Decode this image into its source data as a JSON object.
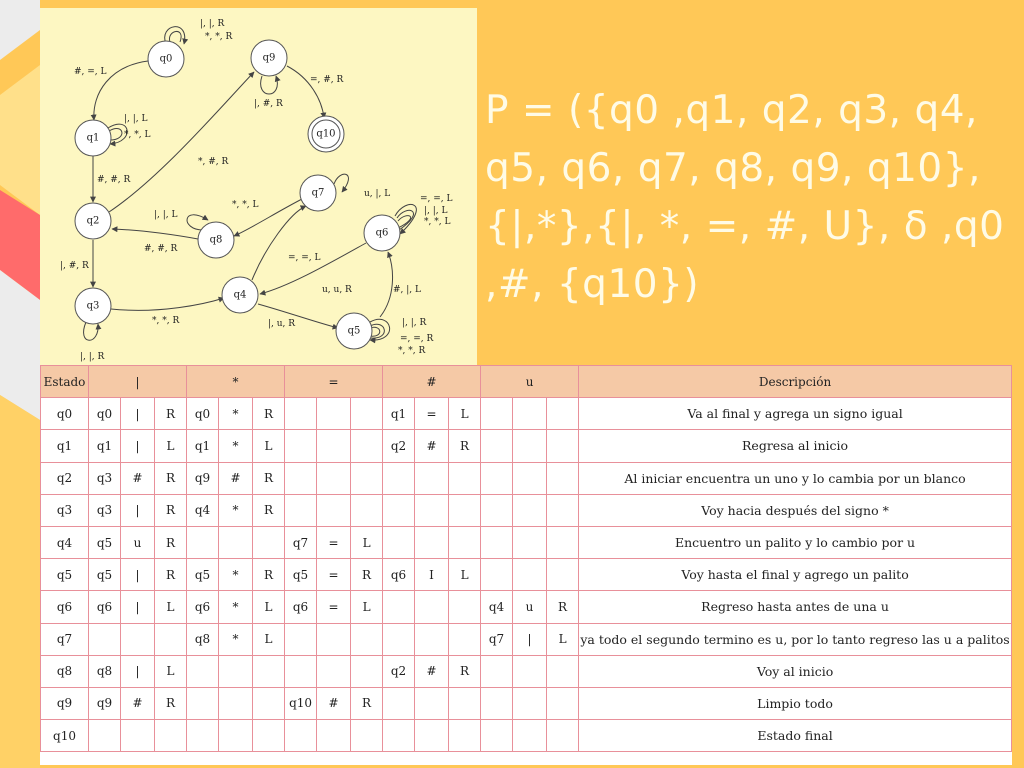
{
  "diagram": {
    "states": [
      "q0",
      "q1",
      "q2",
      "q3",
      "q4",
      "q5",
      "q6",
      "q7",
      "q8",
      "q9",
      "q10"
    ],
    "edge_labels": {
      "q0_loop_1": "|, |, R",
      "q0_loop_2": "*, *, R",
      "q0_q1": "#, =, L",
      "q1_loop_1": "|, |, L",
      "q1_loop_2": "*, *, L",
      "q1_q2": "#, #, R",
      "q2_q9": "*, #, R",
      "q2_q3": "|, #, R",
      "q9_loop": "|, #, R",
      "q9_q10": "=, #, R",
      "q8_loop": "|, |, L",
      "q8_q2": "#, #, R",
      "q7_q8": "*, *, L",
      "q7_loop": "u, |, L",
      "q6_loop_1": "=, =, L",
      "q6_loop_2": "|, |, L",
      "q6_loop_3": "*, *, L",
      "q4_q7": "=, =, L",
      "q6_q4": "u, u, R",
      "q5_q6": "#, |, L",
      "q3_q4": "*, *, R",
      "q3_loop": "|, |, R",
      "q4_q5": "|, u, R",
      "q5_loop_1": "|, |, R",
      "q5_loop_2": "=, =, R",
      "q5_loop_3": "*, *, R"
    }
  },
  "formula": {
    "line1": "P = ({q0 ,q1, q2, q3, q4,",
    "line2": "q5, q6, q7, q8, q9, q10},",
    "line3": "{|,*},{|, *, =, #, U}, δ ,q0",
    "line4": ",#, {q10})"
  },
  "table": {
    "headers": [
      "Estado",
      "|",
      "*",
      "=",
      "#",
      "u",
      "Descripción"
    ],
    "rows": [
      {
        "state": "q0",
        "cells": [
          "q0",
          "|",
          "R",
          "q0",
          "*",
          "R",
          "",
          "",
          "",
          "q1",
          "=",
          "L",
          "",
          "",
          ""
        ],
        "desc": "Va al final y agrega un signo igual"
      },
      {
        "state": "q1",
        "cells": [
          "q1",
          "|",
          "L",
          "q1",
          "*",
          "L",
          "",
          "",
          "",
          "q2",
          "#",
          "R",
          "",
          "",
          ""
        ],
        "desc": "Regresa al inicio"
      },
      {
        "state": "q2",
        "cells": [
          "q3",
          "#",
          "R",
          "q9",
          "#",
          "R",
          "",
          "",
          "",
          "",
          "",
          "",
          "",
          "",
          ""
        ],
        "desc": "Al iniciar encuentra un uno y lo cambia por un blanco"
      },
      {
        "state": "q3",
        "cells": [
          "q3",
          "|",
          "R",
          "q4",
          "*",
          "R",
          "",
          "",
          "",
          "",
          "",
          "",
          "",
          "",
          ""
        ],
        "desc": "Voy hacia después del signo *"
      },
      {
        "state": "q4",
        "cells": [
          "q5",
          "u",
          "R",
          "",
          "",
          "",
          "q7",
          "=",
          "L",
          "",
          "",
          "",
          "",
          "",
          ""
        ],
        "desc": "Encuentro un palito y lo cambio por u"
      },
      {
        "state": "q5",
        "cells": [
          "q5",
          "|",
          "R",
          "q5",
          "*",
          "R",
          "q5",
          "=",
          "R",
          "q6",
          "I",
          "L",
          "",
          "",
          ""
        ],
        "desc": "Voy hasta el final y agrego un palito"
      },
      {
        "state": "q6",
        "cells": [
          "q6",
          "|",
          "L",
          "q6",
          "*",
          "L",
          "q6",
          "=",
          "L",
          "",
          "",
          "",
          "q4",
          "u",
          "R"
        ],
        "desc": "Regreso hasta antes de una u"
      },
      {
        "state": "q7",
        "cells": [
          "",
          "",
          "",
          "q8",
          "*",
          "L",
          "",
          "",
          "",
          "",
          "",
          "",
          "q7",
          "|",
          "L"
        ],
        "desc": "ya todo el segundo termino es u, por lo tanto regreso las u a palitos"
      },
      {
        "state": "q8",
        "cells": [
          "q8",
          "|",
          "L",
          "",
          "",
          "",
          "",
          "",
          "",
          "q2",
          "#",
          "R",
          "",
          "",
          ""
        ],
        "desc": "Voy al inicio"
      },
      {
        "state": "q9",
        "cells": [
          "q9",
          "#",
          "R",
          "",
          "",
          "",
          "q10",
          "#",
          "R",
          "",
          "",
          "",
          "",
          "",
          ""
        ],
        "desc": "Limpio todo"
      },
      {
        "state": "q10",
        "cells": [
          "",
          "",
          "",
          "",
          "",
          "",
          "",
          "",
          "",
          "",
          "",
          "",
          "",
          "",
          ""
        ],
        "desc": "Estado final"
      }
    ]
  }
}
